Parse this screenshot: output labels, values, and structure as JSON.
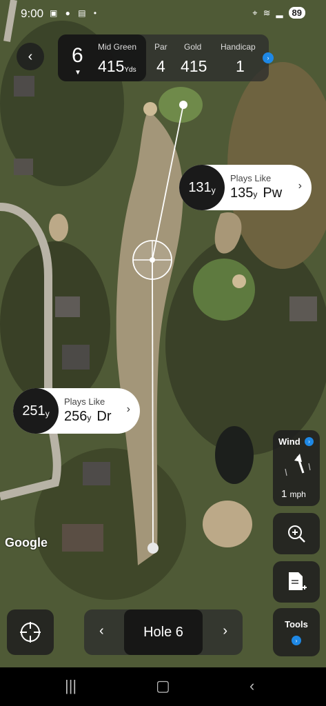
{
  "status_bar": {
    "time": "9:00",
    "notification_icons": "▣ ● ▤ •",
    "battery": "89"
  },
  "hole_info": {
    "hole_number": "6",
    "mid_green_label": "Mid Green",
    "mid_green_value": "415",
    "mid_green_unit": "Yds",
    "par_label": "Par",
    "par_value": "4",
    "tee_label": "Gold",
    "tee_value": "415",
    "handicap_label": "Handicap",
    "handicap_value": "1"
  },
  "plays_like_upper": {
    "distance": "131",
    "unit": "y",
    "label": "Plays Like",
    "adjusted": "135",
    "adjusted_unit": "y",
    "club": "Pw"
  },
  "plays_like_lower": {
    "distance": "251",
    "unit": "y",
    "label": "Plays Like",
    "adjusted": "256",
    "adjusted_unit": "y",
    "club": "Dr"
  },
  "wind": {
    "label": "Wind",
    "speed": "1",
    "unit": "mph"
  },
  "tools": {
    "label": "Tools"
  },
  "hole_nav": {
    "label": "Hole 6"
  },
  "map": {
    "attribution": "Google"
  },
  "icons": {
    "back": "chevron-left-icon",
    "info": "info-icon",
    "zoom": "zoom-in-icon",
    "scorecard": "scorecard-add-icon",
    "locate": "crosshair-icon",
    "prev": "chevron-left-icon",
    "next": "chevron-right-icon"
  },
  "colors": {
    "accent": "#1e88e5",
    "pill_bg": "#ffffff",
    "dark_panel": "#1a1a1a"
  }
}
